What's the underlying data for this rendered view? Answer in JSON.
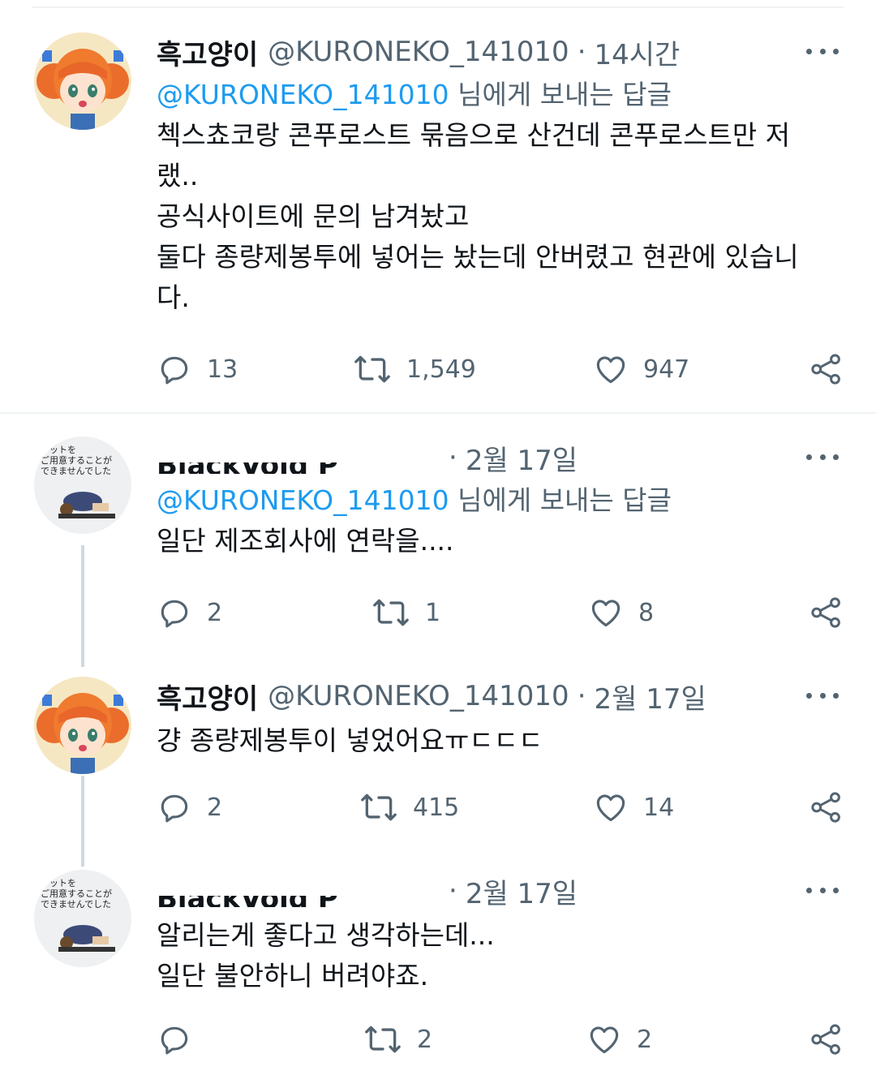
{
  "tweets": [
    {
      "name": "흑고양이",
      "handle": "@KURONEKO_141010",
      "time": "14시간",
      "replying_mention": "@KURONEKO_141010",
      "replying_suffix": " 님에게 보내는 답글",
      "text": "첵스쵸코랑 콘푸로스트 묶음으로 산건데 콘푸로스트만 저\n랬..\n공식사이트에 문의 남겨놨고\n둘다 종량제봉투에 넣어는 놨는데 안버렸고 현관에 있습니\n다.",
      "replies": "13",
      "retweets": "1,549",
      "likes": "947"
    },
    {
      "name": "BlackVoid P",
      "time": "2월 17일",
      "replying_mention": "@KURONEKO_141010",
      "replying_suffix": " 님에게 보내는 답글",
      "text": "일단 제조회사에 연락을....",
      "replies": "2",
      "retweets": "1",
      "likes": "8"
    },
    {
      "name": "흑고양이",
      "handle": "@KURONEKO_141010",
      "time": "2월 17일",
      "text": "걍 종량제봉투이 넣었어요ㅠㄷㄷㄷ",
      "replies": "2",
      "retweets": "415",
      "likes": "14"
    },
    {
      "name": "BlackVoid P",
      "time": "2월 17일",
      "text": "알리는게 좋다고 생각하는데...\n일단 불안하니 버려야죠.",
      "replies": "",
      "retweets": "2",
      "likes": "2"
    }
  ],
  "avatar_text": [
    "ケットを",
    "ご用意することが",
    "できませんでした"
  ],
  "sep": "·",
  "icons": [
    "more-icon",
    "reply-icon",
    "retweet-icon",
    "like-icon",
    "share-icon"
  ],
  "colors": {
    "text": "#0f1419",
    "secondary": "#536471",
    "link": "#1d9bf0",
    "divider": "#eff3f4",
    "thread": "#cfd9de"
  }
}
